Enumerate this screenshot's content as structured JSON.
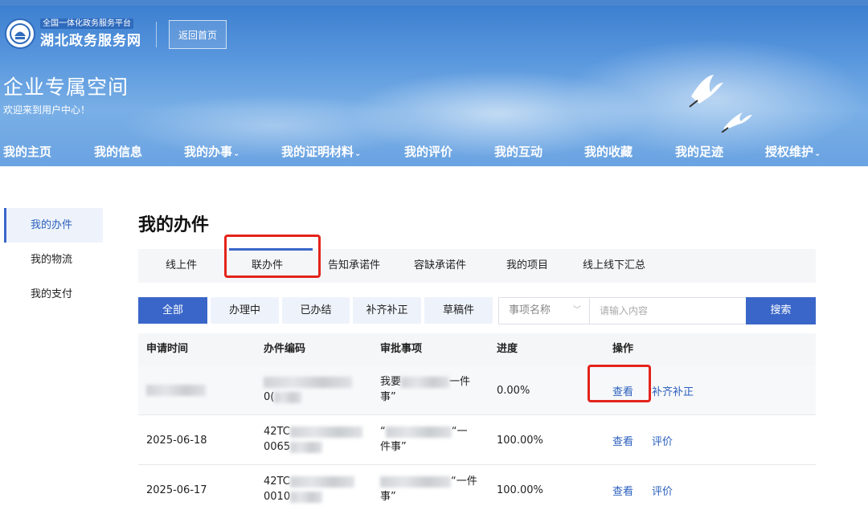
{
  "header": {
    "platform_small": "全国一体化政务服务平台",
    "platform_name": "湖北政务服务网",
    "home_button": "返回首页",
    "space_title": "企业专属空间",
    "welcome": "欢迎来到用户中心！"
  },
  "nav": {
    "items": [
      {
        "label": "我的主页"
      },
      {
        "label": "我的信息"
      },
      {
        "label": "我的办事",
        "caret": "⌄"
      },
      {
        "label": "我的证明材料",
        "caret": "⌄"
      },
      {
        "label": "我的评价"
      },
      {
        "label": "我的互动"
      },
      {
        "label": "我的收藏"
      },
      {
        "label": "我的足迹"
      },
      {
        "label": "授权维护",
        "caret": "⌄"
      }
    ],
    "active_index": 2
  },
  "sidebar": {
    "items": [
      {
        "label": "我的办件"
      },
      {
        "label": "我的物流"
      },
      {
        "label": "我的支付"
      }
    ]
  },
  "main": {
    "title": "我的办件",
    "tabs": [
      {
        "label": "线上件"
      },
      {
        "label": "联办件"
      },
      {
        "label": "告知承诺件"
      },
      {
        "label": "容缺承诺件"
      },
      {
        "label": "我的项目"
      },
      {
        "label": "线上线下汇总"
      }
    ],
    "active_tab": 1,
    "filters": [
      {
        "label": "全部"
      },
      {
        "label": "办理中"
      },
      {
        "label": "已办结"
      },
      {
        "label": "补齐补正"
      },
      {
        "label": "草稿件"
      }
    ],
    "active_filter": 0,
    "search": {
      "select_value": "事项名称",
      "placeholder": "请输入内容",
      "button": "搜索"
    },
    "table": {
      "columns": [
        "申请时间",
        "办件编码",
        "审批事项",
        "进度",
        "操作"
      ],
      "rows": [
        {
          "date": "",
          "code": [
            "",
            "0("
          ],
          "item": [
            "我要",
            "一件",
            "事”"
          ],
          "progress": "0.00%",
          "actions": [
            "查看",
            "补齐补正"
          ]
        },
        {
          "date": "2025-06-18",
          "code": [
            "42TC",
            "0065"
          ],
          "item": [
            "“",
            "“一",
            "件事”"
          ],
          "progress": "100.00%",
          "actions": [
            "查看",
            "评价"
          ]
        },
        {
          "date": "2025-06-17",
          "code": [
            "42TC",
            "0010"
          ],
          "item": [
            "",
            "“一件",
            "事”"
          ],
          "progress": "100.00%",
          "actions": [
            "查看",
            "评价"
          ]
        }
      ]
    }
  },
  "colors": {
    "primary": "#3a66c9",
    "highlight": "#e3241b",
    "header_bg": "#5a98de"
  }
}
